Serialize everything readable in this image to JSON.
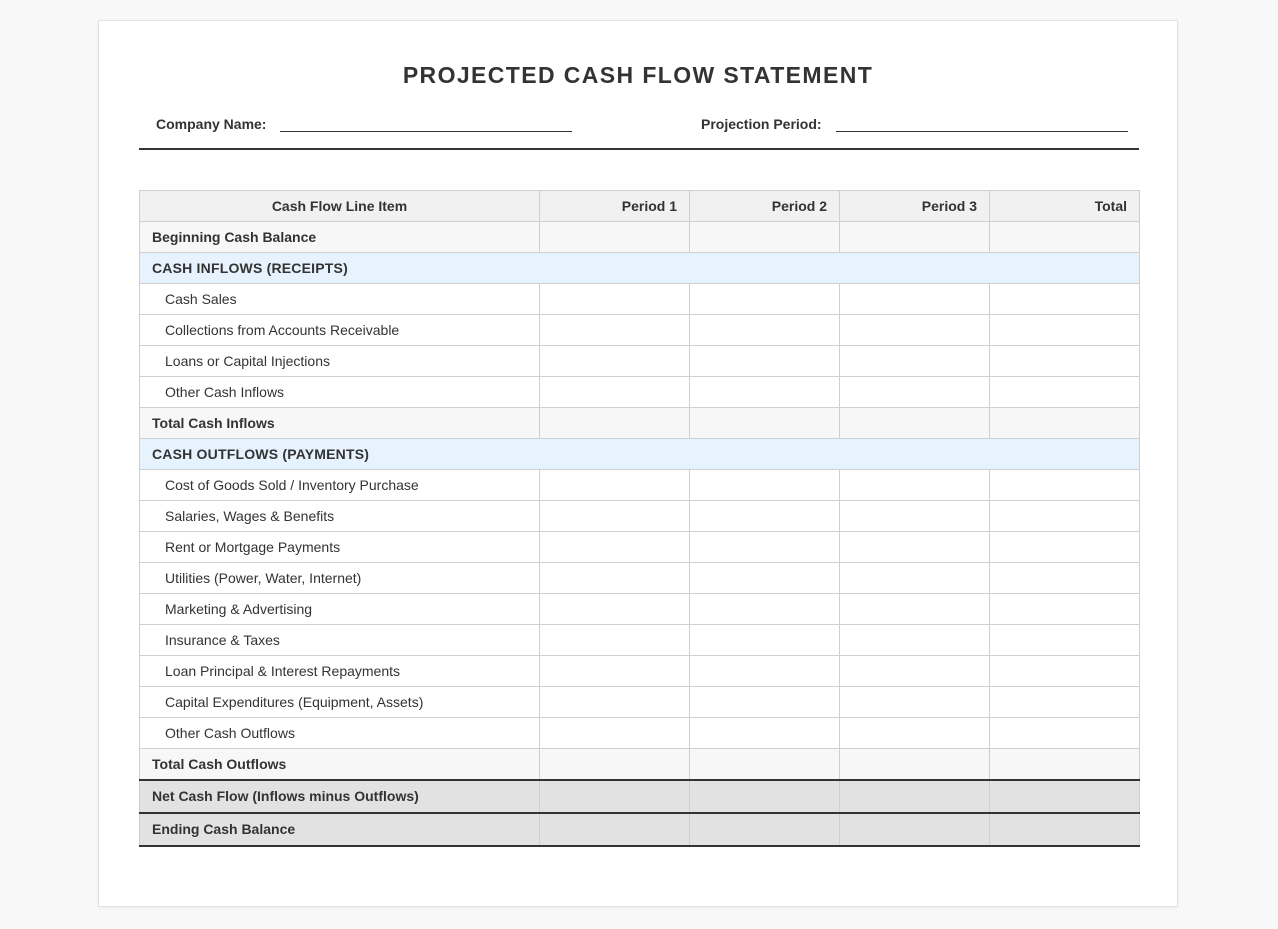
{
  "document": {
    "title": "PROJECTED CASH FLOW STATEMENT",
    "company_label": "Company Name:",
    "period_label": "Projection Period:"
  },
  "table": {
    "headers": [
      "Cash Flow Line Item",
      "Period 1",
      "Period 2",
      "Period 3",
      "Total"
    ],
    "beginning": "Beginning Cash Balance",
    "inflows_section": "CASH INFLOWS (RECEIPTS)",
    "inflows": [
      "Cash Sales",
      "Collections from Accounts Receivable",
      "Loans or Capital Injections",
      "Other Cash Inflows"
    ],
    "total_inflows": "Total Cash Inflows",
    "outflows_section": "CASH OUTFLOWS (PAYMENTS)",
    "outflows": [
      "Cost of Goods Sold / Inventory Purchase",
      "Salaries, Wages & Benefits",
      "Rent or Mortgage Payments",
      "Utilities (Power, Water, Internet)",
      "Marketing & Advertising",
      "Insurance & Taxes",
      "Loan Principal & Interest Repayments",
      "Capital Expenditures (Equipment, Assets)",
      "Other Cash Outflows"
    ],
    "total_outflows": "Total Cash Outflows",
    "net_flow": "Net Cash Flow (Inflows minus Outflows)",
    "ending": "Ending Cash Balance"
  }
}
